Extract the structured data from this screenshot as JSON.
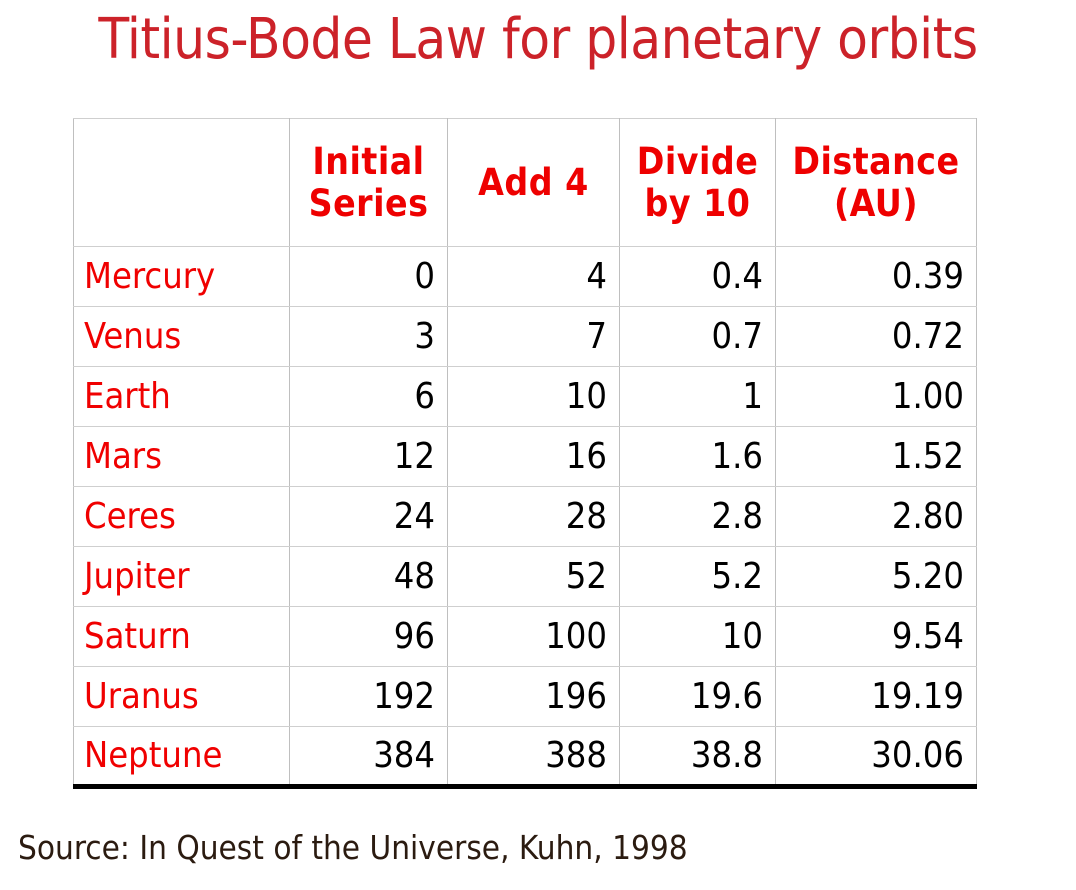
{
  "slide": {
    "title": "Titius-Bode Law for planetary orbits",
    "source": "Source: In Quest of the Universe, Kuhn, 1998",
    "title_color": "#CC2229",
    "header_color": "#EE0000",
    "row_label_color": "#F00000",
    "value_color": "#000000",
    "source_color": "#2B1B10",
    "background_color": "#FFFFFF"
  },
  "table": {
    "headers": [
      {
        "line1": "",
        "line2": ""
      },
      {
        "line1": "Initial",
        "line2": "Series"
      },
      {
        "line1": "",
        "line2": "Add 4"
      },
      {
        "line1": "Divide",
        "line2": "by 10"
      },
      {
        "line1": "Distance",
        "line2": "(AU)"
      }
    ],
    "rows": [
      {
        "name": "Mercury",
        "initial_series": "0",
        "add_4": "4",
        "divide_by_10": "0.4",
        "distance_au": "0.39"
      },
      {
        "name": "Venus",
        "initial_series": "3",
        "add_4": "7",
        "divide_by_10": "0.7",
        "distance_au": "0.72"
      },
      {
        "name": "Earth",
        "initial_series": "6",
        "add_4": "10",
        "divide_by_10": "1",
        "distance_au": "1.00"
      },
      {
        "name": "Mars",
        "initial_series": "12",
        "add_4": "16",
        "divide_by_10": "1.6",
        "distance_au": "1.52"
      },
      {
        "name": "Ceres",
        "initial_series": "24",
        "add_4": "28",
        "divide_by_10": "2.8",
        "distance_au": "2.80"
      },
      {
        "name": "Jupiter",
        "initial_series": "48",
        "add_4": "52",
        "divide_by_10": "5.2",
        "distance_au": "5.20"
      },
      {
        "name": "Saturn",
        "initial_series": "96",
        "add_4": "100",
        "divide_by_10": "10",
        "distance_au": "9.54"
      },
      {
        "name": "Uranus",
        "initial_series": "192",
        "add_4": "196",
        "divide_by_10": "19.6",
        "distance_au": "19.19"
      },
      {
        "name": "Neptune",
        "initial_series": "384",
        "add_4": "388",
        "divide_by_10": "38.8",
        "distance_au": "30.06"
      }
    ]
  },
  "chart_data": {
    "type": "table",
    "title": "Titius-Bode Law for planetary orbits",
    "columns": [
      "",
      "Initial Series",
      "Add 4",
      "Divide by 10",
      "Distance (AU)"
    ],
    "categories": [
      "Mercury",
      "Venus",
      "Earth",
      "Mars",
      "Ceres",
      "Jupiter",
      "Saturn",
      "Uranus",
      "Neptune"
    ],
    "series": [
      {
        "name": "Initial Series",
        "values": [
          0,
          3,
          6,
          12,
          24,
          48,
          96,
          192,
          384
        ]
      },
      {
        "name": "Add 4",
        "values": [
          4,
          7,
          10,
          16,
          28,
          52,
          100,
          196,
          388
        ]
      },
      {
        "name": "Divide by 10",
        "values": [
          0.4,
          0.7,
          1,
          1.6,
          2.8,
          5.2,
          10,
          19.6,
          38.8
        ]
      },
      {
        "name": "Distance (AU)",
        "values": [
          0.39,
          0.72,
          1.0,
          1.52,
          2.8,
          5.2,
          9.54,
          19.19,
          30.06
        ]
      }
    ],
    "xlabel": "",
    "ylabel": "",
    "annotations": [
      "Source: In Quest of the Universe, Kuhn, 1998"
    ]
  }
}
